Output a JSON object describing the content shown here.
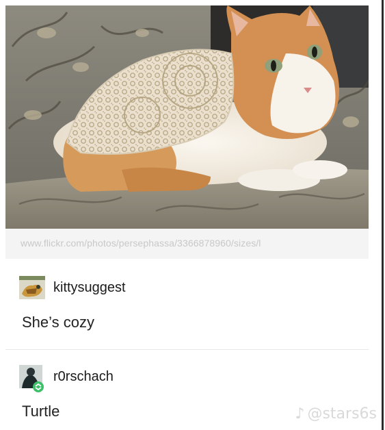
{
  "photo": {
    "alt": "orange and white cat wearing a crocheted doily on a couch"
  },
  "source_url": "www.flickr.com/photos/persephassa/3366878960/sizes/l",
  "reblogs": [
    {
      "username": "kittysuggest",
      "comment": "She’s cozy",
      "avatar_icon": "cat-avatar-icon"
    },
    {
      "username": "r0rschach",
      "comment": "Turtle",
      "avatar_icon": "person-avatar-icon"
    }
  ],
  "watermark": {
    "icon": "tiktok-icon",
    "handle": "@stars6s"
  },
  "colors": {
    "text": "#1a1a1a",
    "url_text": "#c8c8c8",
    "reblog_badge": "#3fbf6a"
  }
}
